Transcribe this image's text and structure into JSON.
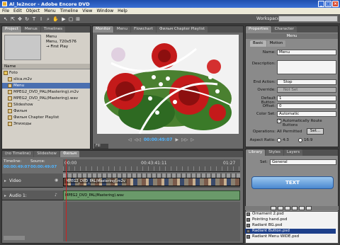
{
  "window": {
    "title": "Al_le2ncor - Adobe Encore DVD",
    "icon": "encore-app-icon"
  },
  "menu": [
    "File",
    "Edit",
    "Object",
    "Menu",
    "Timeline",
    "View",
    "Window",
    "Help"
  ],
  "toolbar": {
    "workspace_label": "Workspace:",
    "workspace_value": ""
  },
  "project_panel": {
    "tabs": [
      "Project",
      "Menus",
      "Timelines"
    ],
    "preview_lines": [
      "Menu",
      "Menu, 720x576",
      "First Play"
    ],
    "column_header": "Name",
    "items": [
      "Foto",
      "slica.m2v",
      "Menu",
      "MPEG2_DVD_PAL(Mastering).m2v",
      "MPEG2_DVD_PAL(Mastering).wav",
      "Slideshow",
      "Фильм",
      "Фильм Chapter Playlist",
      "Эпизоды"
    ],
    "selected_index": 2
  },
  "monitor_panel": {
    "tabs": [
      "Monitor",
      "Menu",
      "Flowchart",
      "Фильм Chapter Playlist"
    ],
    "timecode": "00:00:49:07",
    "zoom": "Fill"
  },
  "properties_panel": {
    "tabs": [
      "Properties",
      "Character"
    ],
    "header": "Menu",
    "subtabs": [
      "Basic",
      "Motion"
    ],
    "name_label": "Name:",
    "name_value": "Menu",
    "description_label": "Description:",
    "end_action_label": "End Action:",
    "end_action_value": "Stop",
    "override_label": "Override:",
    "override_value": "Not Set",
    "default_button_label": "Default Button:",
    "default_button_value": "1",
    "offset_label": "Offset:",
    "offset_value": "0",
    "color_set_label": "Color Set:",
    "color_set_value": "Automatic",
    "auto_route_label": "Automatically Route Buttons",
    "operations_label": "Operations:",
    "operations_value": "All Permitted",
    "set_button": "Set...",
    "aspect_label": "Aspect Ratio:",
    "aspect_4_3": "4:3",
    "aspect_16_9": "16:9"
  },
  "library_panel": {
    "tabs": [
      "Library",
      "Styles",
      "Layers"
    ],
    "set_label": "Set:",
    "set_value": "General",
    "preview_text": "TEXT",
    "items": [
      "Ornament 2.psd",
      "Pointing hand.psd",
      "Radiant BG.psd",
      "Radiant Button.psd",
      "Radiant Menu WIDE.psd"
    ],
    "selected_index": 3
  },
  "timeline_panel": {
    "tabs": [
      "(no Timeline)",
      "Slideshow",
      "Фильм"
    ],
    "timeline_label": "Timeline:",
    "timeline_tc": "00:00:49:07",
    "source_label": "Source:",
    "source_tc": "00:00:49:07",
    "ruler": [
      "00:00",
      "00:43:41:11",
      "01:27"
    ],
    "video_track": "Video",
    "video_clip": "MPEG2_DVD_PAL(Mastering).m2v",
    "audio_track": "Audio 1:",
    "audio_clip": "MPEG2_DVD_PAL(Mastering).wav"
  },
  "colors": {
    "accent_blue": "#1d3f8a",
    "selected_row": "#4a6fb0",
    "titlebar": "#2a5bc4",
    "panel_bg": "#7a7a7a"
  }
}
